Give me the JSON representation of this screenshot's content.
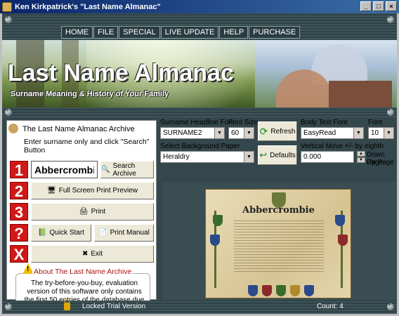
{
  "window": {
    "title": "Ken Kirkpatrick's \"Last Name Almanac\"",
    "minimize": "_",
    "maximize": "□",
    "close": "×"
  },
  "menu": [
    "HOME",
    "FILE",
    "SPECIAL",
    "LIVE UPDATE",
    "HELP",
    "PURCHASE"
  ],
  "banner": {
    "headline": "Last Name Almanac",
    "tagline": "Surname Meaning & History of Your Family"
  },
  "archive": {
    "title": "The Last Name Almanac Archive",
    "instruction": "Enter surname only and click \"Search\" Button",
    "surname_value": "Abbercrombie",
    "steps": [
      "1",
      "2",
      "3",
      "?",
      "X"
    ],
    "search_label": "Search Archive",
    "preview_label": "Full Screen Print Preview",
    "print_label": "Print",
    "quickstart_label": "Quick Start",
    "manual_label": "Print Manual",
    "exit_label": "Exit",
    "about_title": "About The Last Name Archive",
    "about_text": "The try-before-you-buy, evaluation version of this software only contains the first 50 entries of the database due to download size considerations."
  },
  "controls": {
    "headline_font_label": "Surname Headline Font",
    "headline_font_value": "SURNAME2",
    "headline_size_label": "Font Size",
    "headline_size_value": "60",
    "refresh_label": "Refresh",
    "body_font_label": "Body Text Font",
    "body_font_value": "EasyRead",
    "body_size_label": "Font Size",
    "body_size_value": "10",
    "bg_label": "Select Background Paper",
    "bg_value": "Heraldry",
    "defaults_label": "Defaults",
    "vmove_label": "Vertical Move +/-  by eighth inch",
    "vmove_value": "0.000",
    "down_page": "Down Page",
    "up_page": "Up Page"
  },
  "preview": {
    "surname": "Abbercrombie"
  },
  "status": {
    "locked": "Locked Trial Version",
    "count": "Count: 4"
  }
}
